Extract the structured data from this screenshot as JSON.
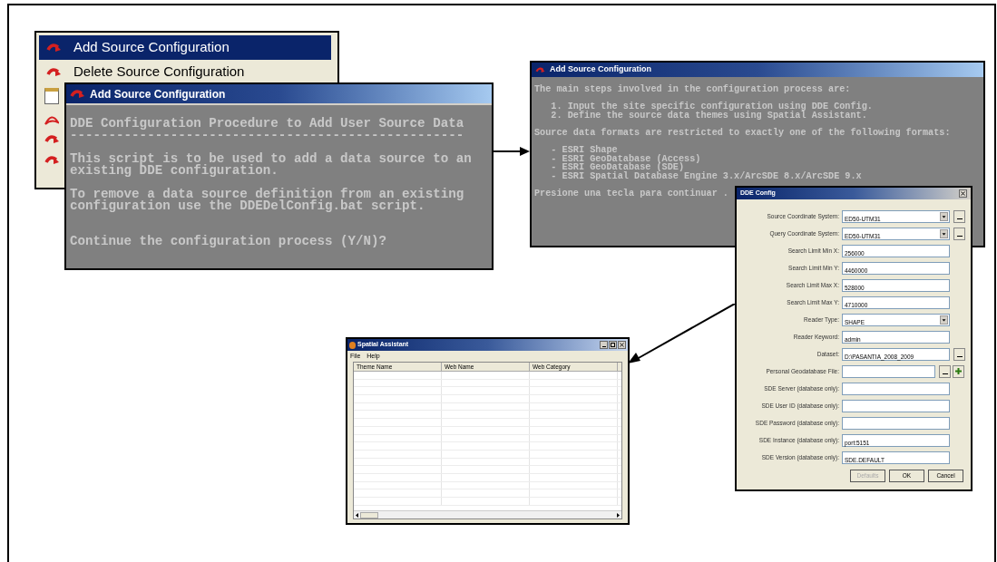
{
  "menu": {
    "items": [
      {
        "label": "Add Source Configuration",
        "selected": true
      },
      {
        "label": "Delete Source Configuration",
        "selected": false
      }
    ]
  },
  "console_main": {
    "title": "Add Source Configuration",
    "text": "DDE Configuration Procedure to Add User Source Data\n---------------------------------------------------\n\nThis script is to be used to add a data source to an\nexisting DDE configuration.\n\nTo remove a data source definition from an existing\nconfiguration use the DDEDelConfig.bat script.\n\n\nContinue the configuration process (Y/N)?"
  },
  "console_steps": {
    "title": "Add Source Configuration",
    "blocks": [
      [
        "The main steps involved in the configuration process are:"
      ],
      [
        "   1. Input the site specific configuration using DDE Config.",
        "   2. Define the source data themes using Spatial Assistant."
      ],
      [
        "Source data formats are restricted to exactly one of the following formats:"
      ],
      [
        "   - ESRI Shape",
        "   - ESRI GeoDatabase (Access)",
        "   - ESRI GeoDatabase (SDE)",
        "   - ESRI Spatial Database Engine 3.x/ArcSDE 8.x/ArcSDE 9.x"
      ],
      [
        "Presione una tecla para continuar ."
      ]
    ]
  },
  "dde_config": {
    "title": "DDE Config",
    "fields": [
      {
        "label": "Source Coordinate System:",
        "value": "ED50-UTM31",
        "kind": "dropdown_browse"
      },
      {
        "label": "Query Coordinate System:",
        "value": "ED50-UTM31",
        "kind": "dropdown_browse"
      },
      {
        "label": "Search Limit Min X:",
        "value": "256000",
        "kind": "text"
      },
      {
        "label": "Search Limit Min Y:",
        "value": "4460000",
        "kind": "text"
      },
      {
        "label": "Search Limit Max X:",
        "value": "528000",
        "kind": "text"
      },
      {
        "label": "Search Limit Max Y:",
        "value": "4710000",
        "kind": "text"
      },
      {
        "label": "Reader Type:",
        "value": "SHAPE",
        "kind": "dropdown"
      },
      {
        "label": "Reader Keyword:",
        "value": "admin",
        "kind": "text"
      },
      {
        "label": "Dataset:",
        "value": "D:\\PASANTIA_2008_2009",
        "kind": "text_browse"
      },
      {
        "label": "Personal Geodatabase File:",
        "kind": "text_browse_add"
      },
      {
        "label": "SDE Server (database only):",
        "kind": "text"
      },
      {
        "label": "SDE User ID (database only):",
        "kind": "text"
      },
      {
        "label": "SDE Password (database only):",
        "kind": "text"
      },
      {
        "label": "SDE Instance (database only):",
        "value": "port:5151",
        "kind": "text"
      },
      {
        "label": "SDE Version (database only):",
        "value": "SDE.DEFAULT",
        "kind": "text"
      }
    ],
    "buttons": [
      {
        "label": "Defaults",
        "disabled": true
      },
      {
        "label": "OK",
        "disabled": false
      },
      {
        "label": "Cancel",
        "disabled": false
      }
    ]
  },
  "spatial_assistant": {
    "title": "Spatial Assistant",
    "menu": [
      "File",
      "Help"
    ],
    "columns": [
      "Theme Name",
      "Web Name",
      "Web Category"
    ]
  }
}
